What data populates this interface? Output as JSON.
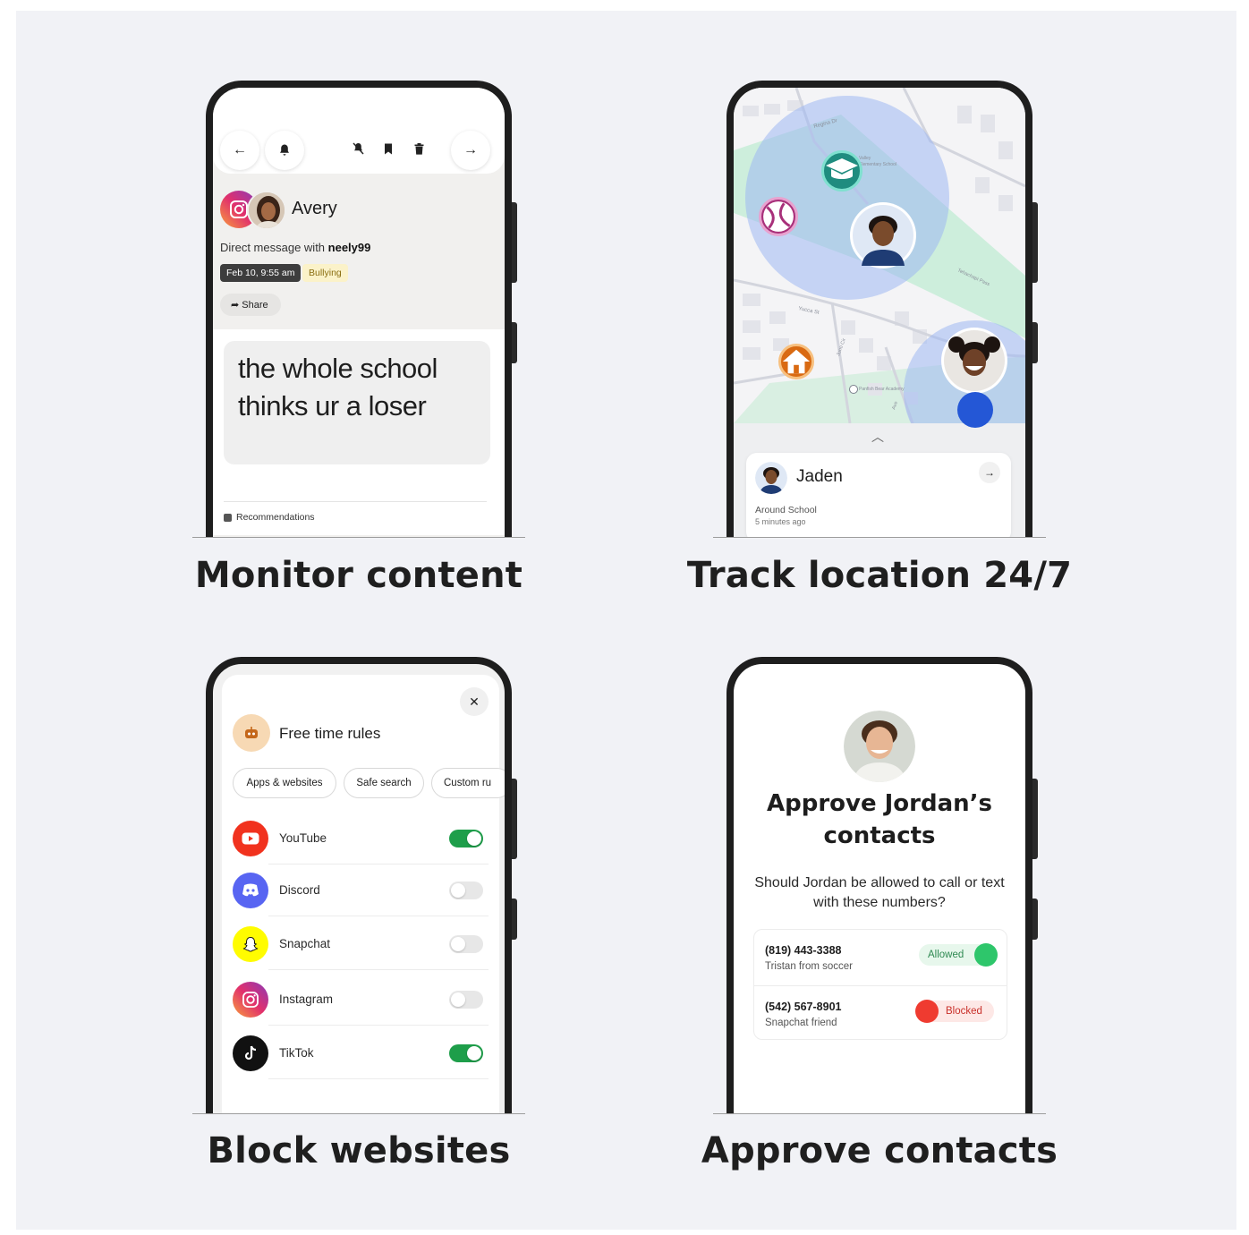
{
  "panels": {
    "monitor": {
      "caption": "Monitor content",
      "contact_name": "Avery",
      "dm_prefix": "Direct message with ",
      "dm_user": "neely99",
      "date": "Feb 10, 9:55 am",
      "tag": "Bullying",
      "share_label": "Share",
      "message": "the whole school thinks ur a loser",
      "recommendations_label": "Recommendations",
      "toolbar_icons": [
        "back-arrow-icon",
        "bell-icon",
        "mute-icon",
        "bookmark-icon",
        "trash-icon",
        "forward-arrow-icon"
      ]
    },
    "location": {
      "caption": "Track location 24/7",
      "child_name": "Jaden",
      "place": "Around School",
      "time_ago": "5 minutes ago",
      "map_labels": [
        "Regina Dr",
        "Yucca St",
        "Valley Elementary School",
        "Tehachapi Pass",
        "Panfish Bear Academy",
        "Juno Cir",
        "Ave"
      ],
      "zone_colors": {
        "school": "#1f8c7f",
        "home": "#d96a12",
        "sport": "#a8307a",
        "radius": "#b9c9f5",
        "park": "#c7ebd4"
      }
    },
    "block": {
      "caption": "Block websites",
      "sheet_title": "Free time rules",
      "tabs": [
        "Apps & websites",
        "Safe search",
        "Custom ru"
      ],
      "apps": [
        {
          "name": "YouTube",
          "enabled": true
        },
        {
          "name": "Discord",
          "enabled": false
        },
        {
          "name": "Snapchat",
          "enabled": false
        },
        {
          "name": "Instagram",
          "enabled": false
        },
        {
          "name": "TikTok",
          "enabled": true
        }
      ],
      "toggle_on_color": "#1e9e4a",
      "toggle_off_color": "#e7e7e7"
    },
    "contacts": {
      "caption": "Approve contacts",
      "title": "Approve Jordan’s contacts",
      "question": "Should Jordan be allowed to call or text with these numbers?",
      "numbers": [
        {
          "number": "(819) 443-3388",
          "label": "Tristan from soccer",
          "status": "Allowed"
        },
        {
          "number": "(542) 567-8901",
          "label": "Snapchat friend",
          "status": "Blocked"
        }
      ],
      "allowed_color": "#2ec66b",
      "blocked_color": "#ef3b30"
    }
  }
}
